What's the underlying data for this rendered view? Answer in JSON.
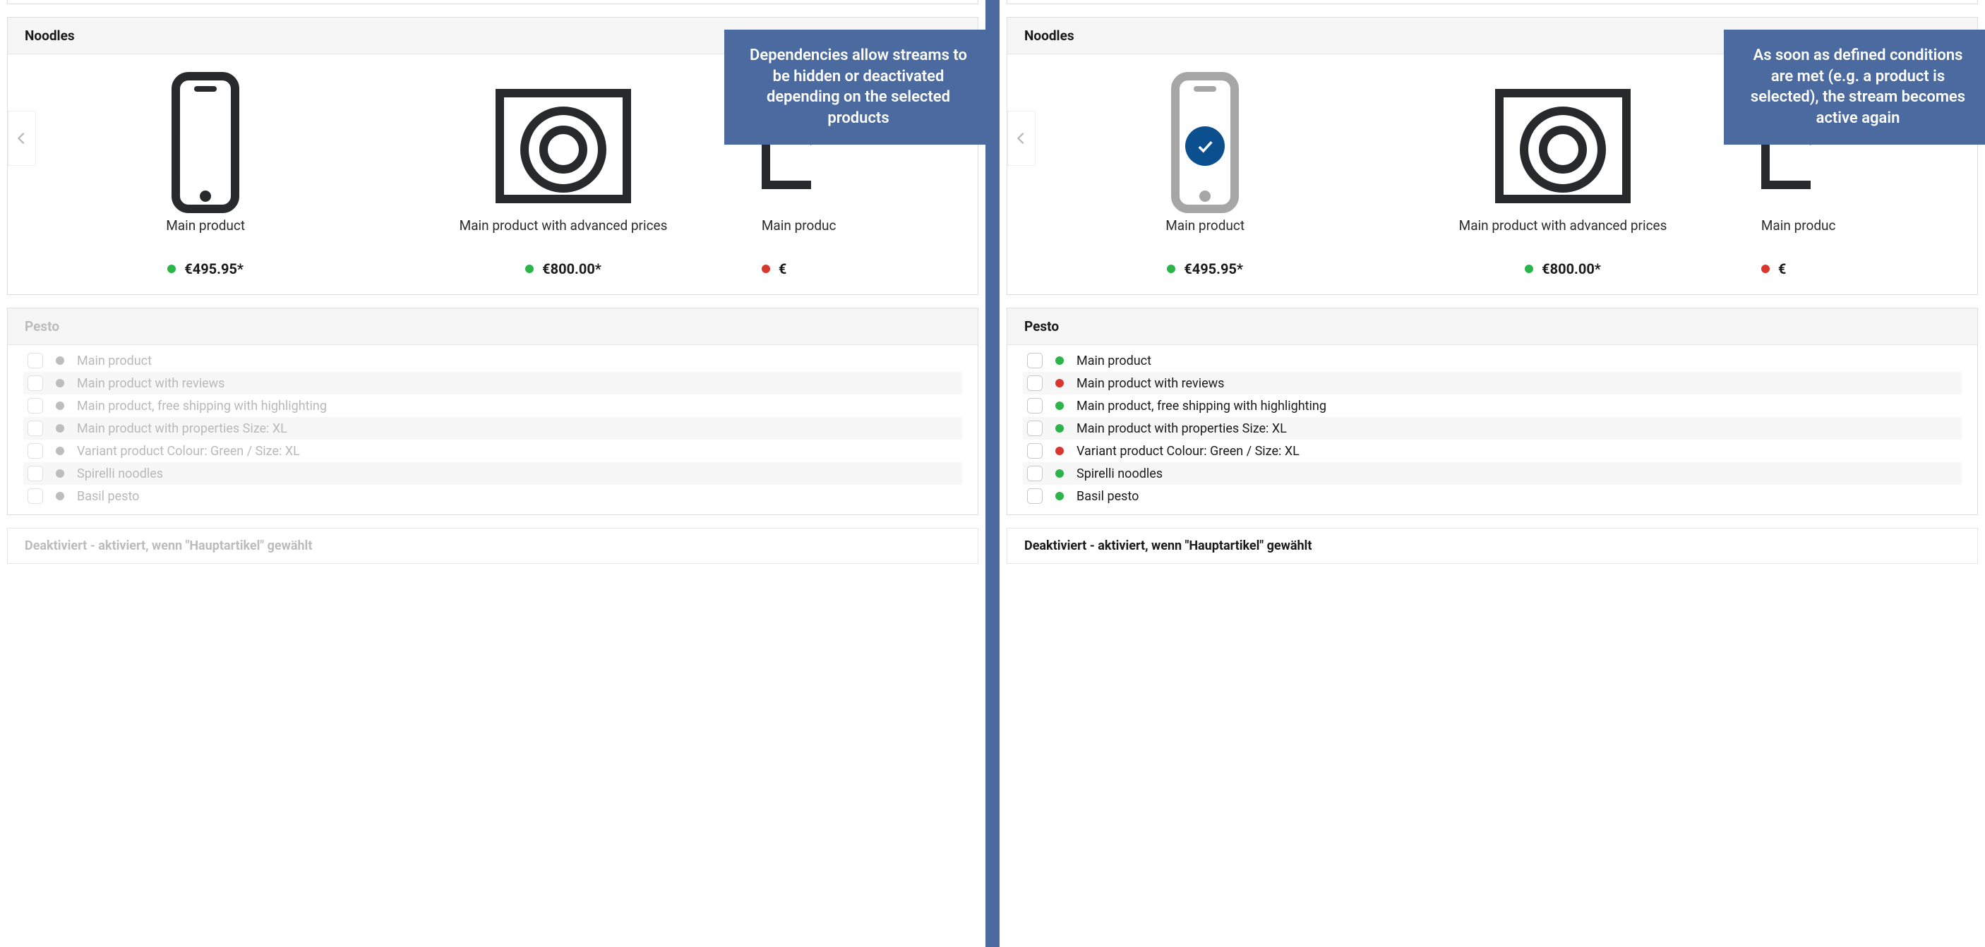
{
  "left": {
    "callout": "Dependencies allow streams to be hidden or deactivated depending on the selected products",
    "noodles_title": "Noodles",
    "products": [
      {
        "name": "Main product",
        "price": "€495.95*",
        "status": "green"
      },
      {
        "name": "Main product with advanced prices",
        "price": "€800.00*",
        "status": "green"
      },
      {
        "name": "Main produc",
        "price": "€",
        "status": "red"
      }
    ],
    "pesto_title": "Pesto",
    "pesto_items": [
      {
        "label": "Main product"
      },
      {
        "label": "Main product with reviews"
      },
      {
        "label": "Main product, free shipping with highlighting"
      },
      {
        "label": "Main product with properties Size: XL"
      },
      {
        "label": "Variant product Colour: Green / Size: XL"
      },
      {
        "label": "Spirelli noodles"
      },
      {
        "label": "Basil pesto"
      }
    ],
    "deactivated_text": "Deaktiviert - aktiviert, wenn \"Hauptartikel\" gewählt"
  },
  "right": {
    "callout": "As soon as defined conditions are met (e.g. a product is selected), the stream becomes active again",
    "noodles_title": "Noodles",
    "products": [
      {
        "name": "Main product",
        "price": "€495.95*",
        "status": "green"
      },
      {
        "name": "Main product with advanced prices",
        "price": "€800.00*",
        "status": "green"
      },
      {
        "name": "Main produc",
        "price": "€",
        "status": "red"
      }
    ],
    "pesto_title": "Pesto",
    "pesto_items": [
      {
        "label": "Main product",
        "status": "green"
      },
      {
        "label": "Main product with reviews",
        "status": "red"
      },
      {
        "label": "Main product, free shipping with highlighting",
        "status": "green"
      },
      {
        "label": "Main product with properties Size: XL",
        "status": "green"
      },
      {
        "label": "Variant product Colour: Green / Size: XL",
        "status": "red"
      },
      {
        "label": "Spirelli noodles",
        "status": "green"
      },
      {
        "label": "Basil pesto",
        "status": "green"
      }
    ],
    "deactivated_text": "Deaktiviert - aktiviert, wenn \"Hauptartikel\" gewählt"
  }
}
